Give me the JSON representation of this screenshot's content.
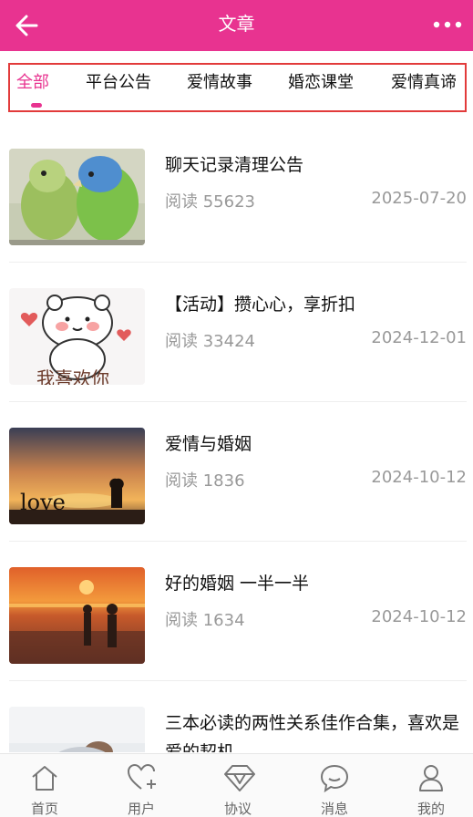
{
  "header": {
    "title": "文章",
    "back_icon": "arrow-left-icon",
    "more_icon": "more-dots-icon",
    "bg_color": "#e83390"
  },
  "tabs": [
    {
      "label": "全部",
      "active": true
    },
    {
      "label": "平台公告",
      "active": false
    },
    {
      "label": "爱情故事",
      "active": false
    },
    {
      "label": "婚恋课堂",
      "active": false
    },
    {
      "label": "爱情真谛",
      "active": false
    }
  ],
  "articles": [
    {
      "title": "聊天记录清理公告",
      "reads": "阅读 55623",
      "date": "2025-07-20",
      "thumb": "parrots"
    },
    {
      "title": "【活动】攒心心，享折扣",
      "reads": "阅读 33424",
      "date": "2024-12-01",
      "thumb": "cartoon-bear",
      "thumb_text": "我喜欢你"
    },
    {
      "title": "爱情与婚姻",
      "reads": "阅读 1836",
      "date": "2024-10-12",
      "thumb": "sunset-love",
      "thumb_text": "love"
    },
    {
      "title": "好的婚姻 一半一半",
      "reads": "阅读 1634",
      "date": "2024-10-12",
      "thumb": "beach-couple"
    },
    {
      "title": "三本必读的两性关系佳作合集，喜欢是爱的契机",
      "thumb": "couple-photo"
    }
  ],
  "bottom_nav": [
    {
      "label": "首页",
      "icon": "home-icon"
    },
    {
      "label": "用户",
      "icon": "heart-plus-icon"
    },
    {
      "label": "协议",
      "icon": "diamond-icon"
    },
    {
      "label": "消息",
      "icon": "chat-icon"
    },
    {
      "label": "我的",
      "icon": "user-icon"
    }
  ]
}
